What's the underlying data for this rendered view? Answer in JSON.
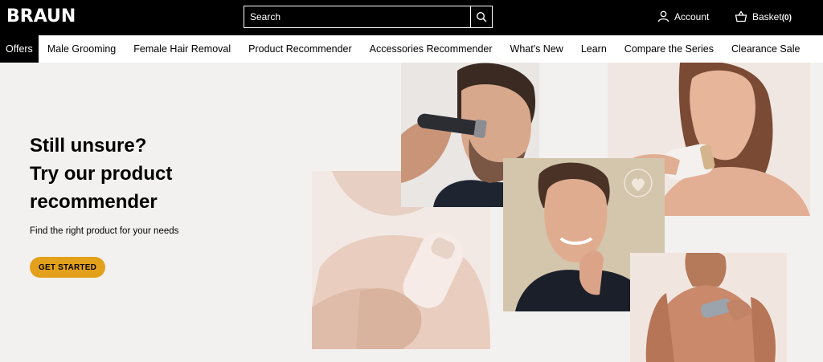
{
  "header": {
    "logo": "BRAUN",
    "search": {
      "placeholder": "Search"
    },
    "account_label": "Account",
    "basket_label": "Basket",
    "basket_count": "(0)"
  },
  "nav": {
    "items": [
      {
        "label": "Offers",
        "active": true
      },
      {
        "label": "Male Grooming"
      },
      {
        "label": "Female Hair Removal"
      },
      {
        "label": "Product Recommender"
      },
      {
        "label": "Accessories Recommender"
      },
      {
        "label": "What's New"
      },
      {
        "label": "Learn"
      },
      {
        "label": "Compare the Series"
      },
      {
        "label": "Clearance Sale"
      }
    ]
  },
  "hero": {
    "title_line1": "Still unsure?",
    "title_line2": "Try our product",
    "title_line3": "recommender",
    "subtitle": "Find the right product for your needs",
    "cta_label": "GET STARTED"
  },
  "colors": {
    "topbar": "#000000",
    "accent": "#e3a01b",
    "hero_bg": "#f3f1f0"
  }
}
